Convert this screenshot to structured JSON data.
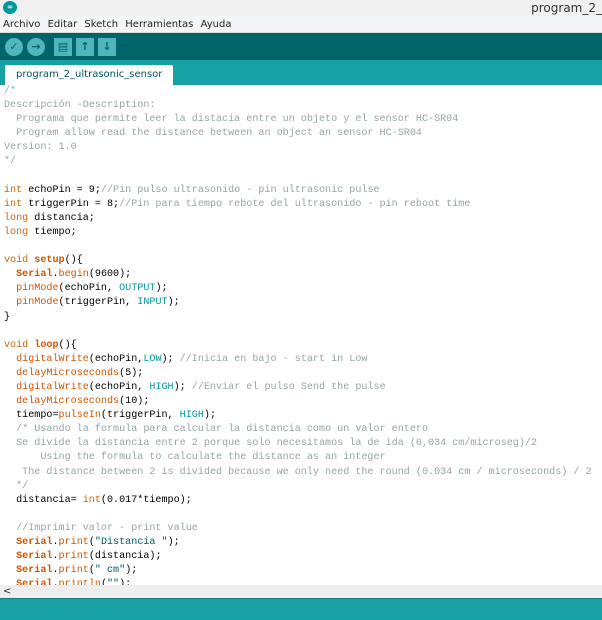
{
  "window": {
    "title": "program_2_",
    "logo": "arduino-logo"
  },
  "menu": [
    "Archivo",
    "Editar",
    "Sketch",
    "Herramientas",
    "Ayuda"
  ],
  "toolbar": {
    "buttons": [
      {
        "name": "verify",
        "icon": "✓"
      },
      {
        "name": "upload",
        "icon": "→"
      },
      {
        "name": "new",
        "icon": "▤"
      },
      {
        "name": "open",
        "icon": "↑"
      },
      {
        "name": "save",
        "icon": "↓"
      }
    ]
  },
  "tab": {
    "label": "program_2_ultrasonic_sensor"
  },
  "colors": {
    "toolbar": "#006468",
    "tabstrip": "#17a1a5",
    "keyword": "#cc6600",
    "function": "#d35400",
    "constant": "#00979c",
    "comment": "#95a5a6"
  },
  "code": [
    [
      [
        "cm",
        "/*"
      ]
    ],
    [
      [
        "cm",
        "Descripción -Description:"
      ]
    ],
    [
      [
        "cm",
        "  Programa que permite leer la distacia entre un objeto y el sensor HC-SR04"
      ]
    ],
    [
      [
        "cm",
        "  Program allow read the distance between an object an sensor HC-SR04"
      ]
    ],
    [
      [
        "cm",
        "Version: 1.0"
      ]
    ],
    [
      [
        "cm",
        "*/"
      ]
    ],
    [],
    [
      [
        "k",
        "int"
      ],
      [
        "t",
        " echoPin = 9;"
      ],
      [
        "cm",
        "//Pin pulso ultrasonido - pin ultrasonic pulse"
      ]
    ],
    [
      [
        "k",
        "int"
      ],
      [
        "t",
        " triggerPin = 8;"
      ],
      [
        "cm",
        "//Pin para tiempo rebote del ultrasonido - pin reboot time"
      ]
    ],
    [
      [
        "k",
        "long"
      ],
      [
        "t",
        " distancia;"
      ]
    ],
    [
      [
        "k",
        "long"
      ],
      [
        "t",
        " tiempo;"
      ]
    ],
    [],
    [
      [
        "k",
        "void"
      ],
      [
        "t",
        " "
      ],
      [
        "kb",
        "setup"
      ],
      [
        "t",
        "(){"
      ]
    ],
    [
      [
        "t",
        "  "
      ],
      [
        "kb",
        "Serial"
      ],
      [
        "t",
        "."
      ],
      [
        "f",
        "begin"
      ],
      [
        "t",
        "(9600);"
      ]
    ],
    [
      [
        "t",
        "  "
      ],
      [
        "f",
        "pinMode"
      ],
      [
        "t",
        "(echoPin, "
      ],
      [
        "c",
        "OUTPUT"
      ],
      [
        "t",
        ");"
      ]
    ],
    [
      [
        "t",
        "  "
      ],
      [
        "f",
        "pinMode"
      ],
      [
        "t",
        "(triggerPin, "
      ],
      [
        "c",
        "INPUT"
      ],
      [
        "t",
        ");"
      ]
    ],
    [
      [
        "t",
        "}"
      ]
    ],
    [],
    [
      [
        "k",
        "void"
      ],
      [
        "t",
        " "
      ],
      [
        "kb",
        "loop"
      ],
      [
        "t",
        "(){"
      ]
    ],
    [
      [
        "t",
        "  "
      ],
      [
        "f",
        "digitalWrite"
      ],
      [
        "t",
        "(echoPin,"
      ],
      [
        "c",
        "LOW"
      ],
      [
        "t",
        "); "
      ],
      [
        "cm",
        "//Inicia en bajo - start in Low"
      ]
    ],
    [
      [
        "t",
        "  "
      ],
      [
        "f",
        "delayMicroseconds"
      ],
      [
        "t",
        "(5);"
      ]
    ],
    [
      [
        "t",
        "  "
      ],
      [
        "f",
        "digitalWrite"
      ],
      [
        "t",
        "(echoPin, "
      ],
      [
        "c",
        "HIGH"
      ],
      [
        "t",
        "); "
      ],
      [
        "cm",
        "//Enviar el pulso Send the pulse"
      ]
    ],
    [
      [
        "t",
        "  "
      ],
      [
        "f",
        "delayMicroseconds"
      ],
      [
        "t",
        "(10);"
      ]
    ],
    [
      [
        "t",
        "  tiempo="
      ],
      [
        "f",
        "pulseIn"
      ],
      [
        "t",
        "(triggerPin, "
      ],
      [
        "c",
        "HIGH"
      ],
      [
        "t",
        ");"
      ]
    ],
    [
      [
        "cm",
        "  /* Usando la formula para calcular la distancia como un valor entero"
      ]
    ],
    [
      [
        "cm",
        "  Se divide la distancia entre 2 porque solo necesitamos la de ida (0,034 cm/microseg)/2"
      ]
    ],
    [
      [
        "cm",
        "      Using the formula to calculate the distance as an integer"
      ]
    ],
    [
      [
        "cm",
        "   The distance between 2 is divided because we only need the round (0.034 cm / microseconds) / 2"
      ]
    ],
    [
      [
        "cm",
        "  */"
      ]
    ],
    [
      [
        "t",
        "  distancia= "
      ],
      [
        "k",
        "int"
      ],
      [
        "t",
        "(0.017*tiempo);"
      ]
    ],
    [],
    [
      [
        "cm",
        "  //Imprimir valor - print value"
      ]
    ],
    [
      [
        "t",
        "  "
      ],
      [
        "kb",
        "Serial"
      ],
      [
        "t",
        "."
      ],
      [
        "f",
        "print"
      ],
      [
        "t",
        "("
      ],
      [
        "s",
        "\"Distancia \""
      ],
      [
        "t",
        ");"
      ]
    ],
    [
      [
        "t",
        "  "
      ],
      [
        "kb",
        "Serial"
      ],
      [
        "t",
        "."
      ],
      [
        "f",
        "print"
      ],
      [
        "t",
        "(distancia);"
      ]
    ],
    [
      [
        "t",
        "  "
      ],
      [
        "kb",
        "Serial"
      ],
      [
        "t",
        "."
      ],
      [
        "f",
        "print"
      ],
      [
        "t",
        "("
      ],
      [
        "s",
        "\" cm\""
      ],
      [
        "t",
        ");"
      ]
    ],
    [
      [
        "t",
        "  "
      ],
      [
        "kb",
        "Serial"
      ],
      [
        "t",
        "."
      ],
      [
        "f",
        "println"
      ],
      [
        "t",
        "("
      ],
      [
        "s",
        "\"\""
      ],
      [
        "t",
        ");"
      ]
    ]
  ],
  "scrollbar": {
    "left_arrow": "<"
  }
}
